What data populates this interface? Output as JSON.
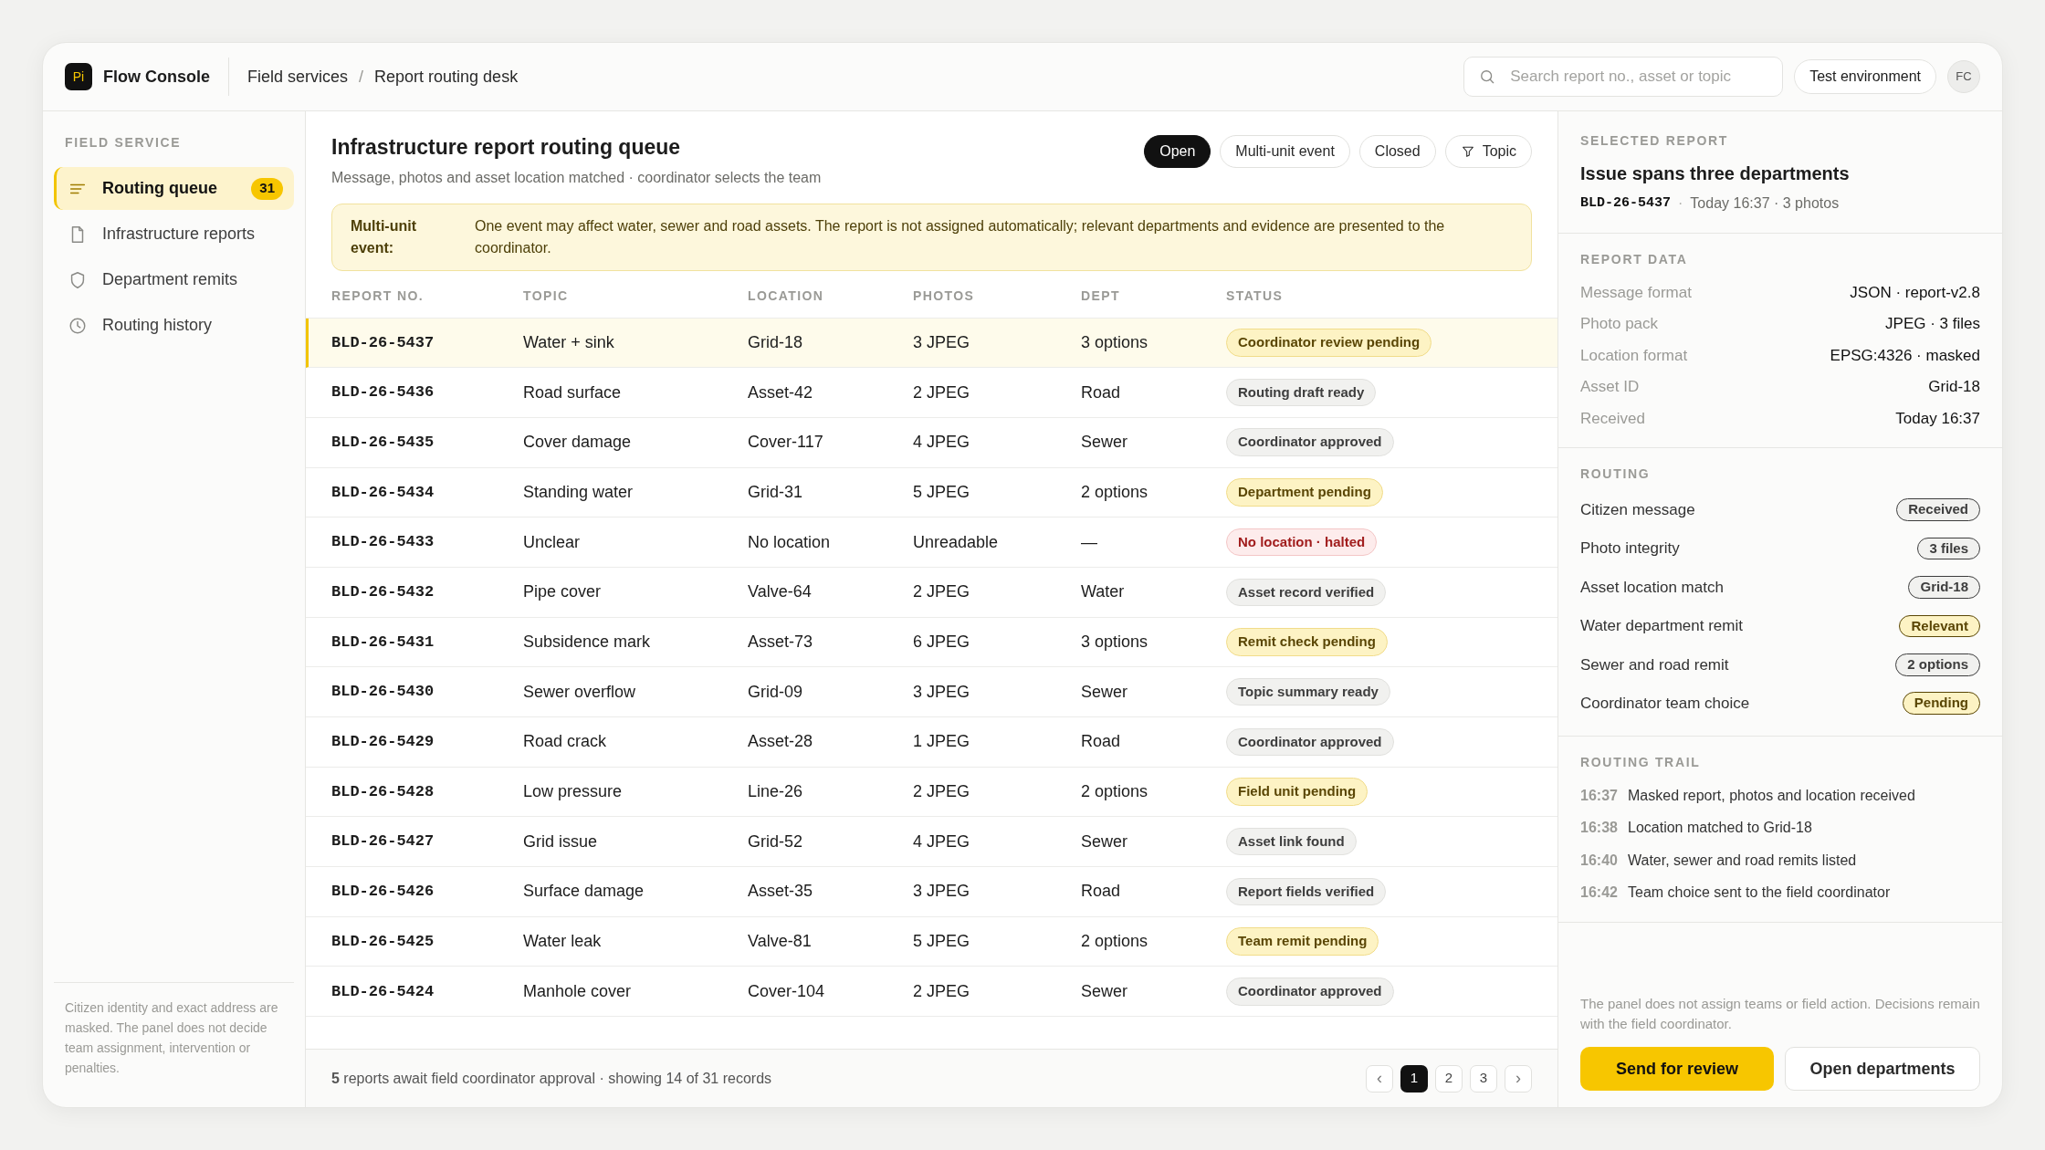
{
  "header": {
    "logo": "Pi",
    "app_name": "Flow Console",
    "breadcrumb": [
      "Field services",
      "Report routing desk"
    ],
    "breadcrumb_separator": "/",
    "search": {
      "placeholder": "Search report no., asset or topic"
    },
    "environment": "Test environment",
    "avatar": "FC"
  },
  "sidebar": {
    "section": "FIELD SERVICE",
    "items": [
      {
        "label": "Routing queue",
        "kind": "list",
        "selected": true,
        "count": "31"
      },
      {
        "label": "Infrastructure reports",
        "kind": "file",
        "selected": false
      },
      {
        "label": "Department remits",
        "kind": "shield",
        "selected": false
      },
      {
        "label": "Routing history",
        "kind": "clock",
        "selected": false
      }
    ],
    "note": "Citizen identity and exact address are masked. The panel does not decide team assignment, intervention or penalties."
  },
  "queue": {
    "title": "Infrastructure report routing queue",
    "subtitle": "Message, photos and asset location matched · coordinator selects the team",
    "filters": [
      {
        "label": "Open",
        "selected": true
      },
      {
        "label": "Multi-unit event",
        "selected": false
      },
      {
        "label": "Closed",
        "selected": false
      },
      {
        "label": "Topic",
        "selected": false,
        "kind": "filter"
      }
    ],
    "notice": {
      "label": "Multi-unit event:",
      "text": "One event may affect water, sewer and road assets. The report is not assigned automatically; relevant departments and evidence are presented to the coordinator."
    },
    "table": {
      "columns": [
        "REPORT NO.",
        "TOPIC",
        "LOCATION",
        "PHOTOS",
        "DEPT",
        "STATUS"
      ],
      "rows": [
        {
          "report_no": "BLD-26-5437",
          "topic": "Water + sink",
          "location": "Grid-18",
          "photos": "3 JPEG",
          "dept": "3 options",
          "status": "Coordinator review pending",
          "color": "#fdf3c4",
          "selected": true
        },
        {
          "report_no": "BLD-26-5436",
          "topic": "Road surface",
          "location": "Asset-42",
          "photos": "2 JPEG",
          "dept": "Road",
          "status": "Routing draft ready",
          "color": "#f1f1ef",
          "selected": false
        },
        {
          "report_no": "BLD-26-5435",
          "topic": "Cover damage",
          "location": "Cover-117",
          "photos": "4 JPEG",
          "dept": "Sewer",
          "status": "Coordinator approved",
          "color": "#f1f1ef",
          "selected": false
        },
        {
          "report_no": "BLD-26-5434",
          "topic": "Standing water",
          "location": "Grid-31",
          "photos": "5 JPEG",
          "dept": "2 options",
          "status": "Department pending",
          "color": "#fdf3c4",
          "selected": false
        },
        {
          "report_no": "BLD-26-5433",
          "topic": "Unclear",
          "location": "No location",
          "photos": "Unreadable",
          "dept": "—",
          "status": "No location · halted",
          "color": "#fdecec",
          "selected": false
        },
        {
          "report_no": "BLD-26-5432",
          "topic": "Pipe cover",
          "location": "Valve-64",
          "photos": "2 JPEG",
          "dept": "Water",
          "status": "Asset record verified",
          "color": "#f1f1ef",
          "selected": false
        },
        {
          "report_no": "BLD-26-5431",
          "topic": "Subsidence mark",
          "location": "Asset-73",
          "photos": "6 JPEG",
          "dept": "3 options",
          "status": "Remit check pending",
          "color": "#fdf3c4",
          "selected": false
        },
        {
          "report_no": "BLD-26-5430",
          "topic": "Sewer overflow",
          "location": "Grid-09",
          "photos": "3 JPEG",
          "dept": "Sewer",
          "status": "Topic summary ready",
          "color": "#f1f1ef",
          "selected": false
        },
        {
          "report_no": "BLD-26-5429",
          "topic": "Road crack",
          "location": "Asset-28",
          "photos": "1 JPEG",
          "dept": "Road",
          "status": "Coordinator approved",
          "color": "#f1f1ef",
          "selected": false
        },
        {
          "report_no": "BLD-26-5428",
          "topic": "Low pressure",
          "location": "Line-26",
          "photos": "2 JPEG",
          "dept": "2 options",
          "status": "Field unit pending",
          "color": "#fdf3c4",
          "selected": false
        },
        {
          "report_no": "BLD-26-5427",
          "topic": "Grid issue",
          "location": "Grid-52",
          "photos": "4 JPEG",
          "dept": "Sewer",
          "status": "Asset link found",
          "color": "#f1f1ef",
          "selected": false
        },
        {
          "report_no": "BLD-26-5426",
          "topic": "Surface damage",
          "location": "Asset-35",
          "photos": "3 JPEG",
          "dept": "Road",
          "status": "Report fields verified",
          "color": "#f1f1ef",
          "selected": false
        },
        {
          "report_no": "BLD-26-5425",
          "topic": "Water leak",
          "location": "Valve-81",
          "photos": "5 JPEG",
          "dept": "2 options",
          "status": "Team remit pending",
          "color": "#fdf3c4",
          "selected": false
        },
        {
          "report_no": "BLD-26-5424",
          "topic": "Manhole cover",
          "location": "Cover-104",
          "photos": "2 JPEG",
          "dept": "Sewer",
          "status": "Coordinator approved",
          "color": "#f1f1ef",
          "selected": false
        }
      ]
    },
    "footer": {
      "summary": "**5** reports await field coordinator approval · showing 14 of 31 records",
      "pages": [
        {
          "label": "‹",
          "kind": "arrow",
          "selected": false
        },
        {
          "label": "1",
          "selected": true
        },
        {
          "label": "2",
          "selected": false
        },
        {
          "label": "3",
          "selected": false
        },
        {
          "label": "›",
          "kind": "arrow",
          "selected": false
        }
      ]
    }
  },
  "detail": {
    "section": "SELECTED REPORT",
    "title": "Issue spans three departments",
    "report_no": "BLD-26-5437",
    "separator": "·",
    "meta": "Today 16:37 · 3 photos",
    "report_data": {
      "heading": "REPORT DATA",
      "fields": [
        {
          "label": "Message format",
          "value": "JSON · report-v2.8"
        },
        {
          "label": "Photo pack",
          "value": "JPEG · 3 files"
        },
        {
          "label": "Location format",
          "value": "EPSG:4326 · masked"
        },
        {
          "label": "Asset ID",
          "value": "Grid-18"
        },
        {
          "label": "Received",
          "value": "Today 16:37"
        }
      ]
    },
    "routing": {
      "heading": "ROUTING",
      "steps": [
        {
          "label": "Citizen message",
          "badge": "Received",
          "color": "#f1f1ef"
        },
        {
          "label": "Photo integrity",
          "badge": "3 files",
          "color": "#f1f1ef"
        },
        {
          "label": "Asset location match",
          "badge": "Grid-18",
          "color": "#f1f1ef"
        },
        {
          "label": "Water department remit",
          "badge": "Relevant",
          "color": "#fdf3c4"
        },
        {
          "label": "Sewer and road remit",
          "badge": "2 options",
          "color": "#f1f1ef"
        },
        {
          "label": "Coordinator team choice",
          "badge": "Pending",
          "color": "#fdf3c4"
        }
      ]
    },
    "trail": {
      "heading": "ROUTING TRAIL",
      "entries": [
        {
          "time": "16:37",
          "text": "Masked report, photos and location received"
        },
        {
          "time": "16:38",
          "text": "Location matched to Grid-18"
        },
        {
          "time": "16:40",
          "text": "Water, sewer and road remits listed"
        },
        {
          "time": "16:42",
          "text": "Team choice sent to the field coordinator"
        }
      ]
    },
    "note": "The panel does not assign teams or field action. Decisions remain with the field coordinator.",
    "buttons": [
      {
        "label": "Send for review",
        "kind": "primary"
      },
      {
        "label": "Open departments",
        "kind": "secondary"
      }
    ]
  }
}
